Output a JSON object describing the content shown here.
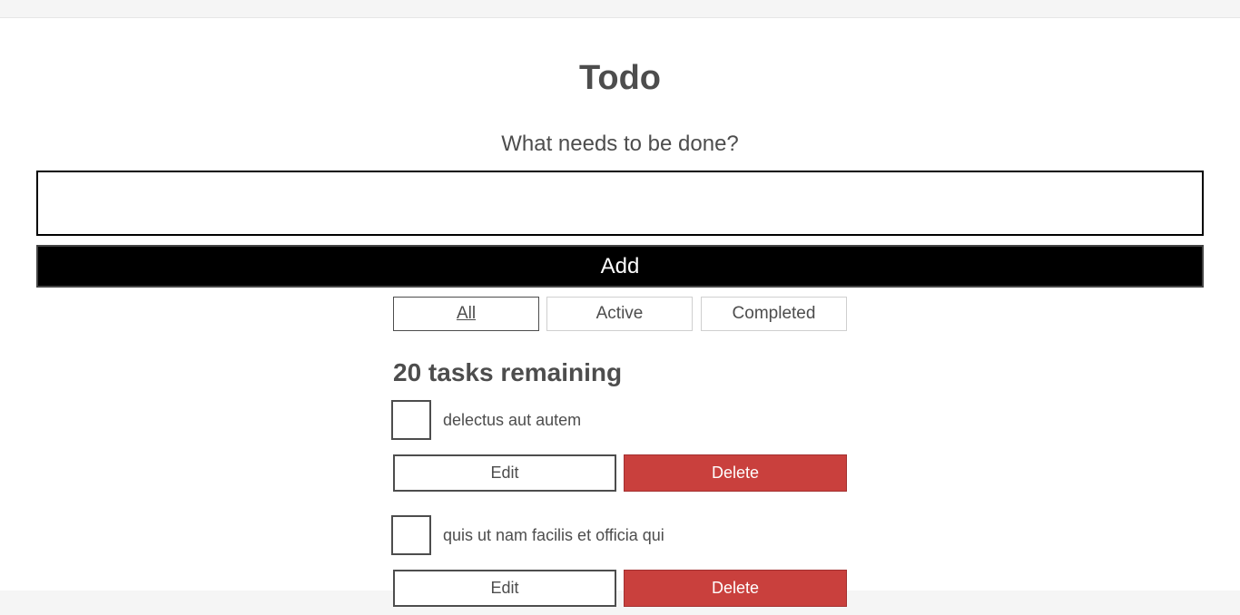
{
  "header": {
    "title": "Todo"
  },
  "new_todo": {
    "label": "What needs to be done?",
    "value": "",
    "add_label": "Add"
  },
  "filters": {
    "all": "All",
    "active": "Active",
    "completed": "Completed",
    "selected": "All"
  },
  "status": {
    "remaining": "20 tasks remaining"
  },
  "todos": [
    {
      "label": "delectus aut autem",
      "completed": false,
      "edit_label": "Edit",
      "delete_label": "Delete"
    },
    {
      "label": "quis ut nam facilis et officia qui",
      "completed": false,
      "edit_label": "Edit",
      "delete_label": "Delete"
    }
  ],
  "colors": {
    "accent": "#000000",
    "danger": "#c9403d",
    "text": "#4d4d4d",
    "page_background": "#f5f5f5"
  }
}
